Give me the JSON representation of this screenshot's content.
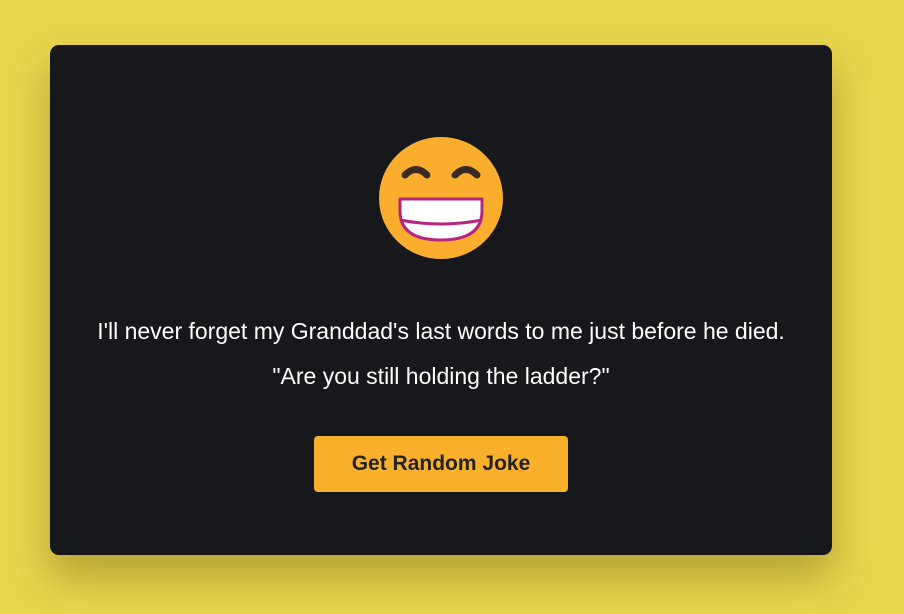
{
  "page": {
    "background_color": "#e9d54e",
    "card_color": "#17181c",
    "accent_color": "#fbb02c"
  },
  "joke": {
    "emoji_icon": "grinning-face-with-smiling-eyes-icon",
    "text": "I'll never forget my Granddad's last words to me just before he died. \"Are you still holding the ladder?\""
  },
  "button": {
    "label": "Get Random Joke"
  }
}
